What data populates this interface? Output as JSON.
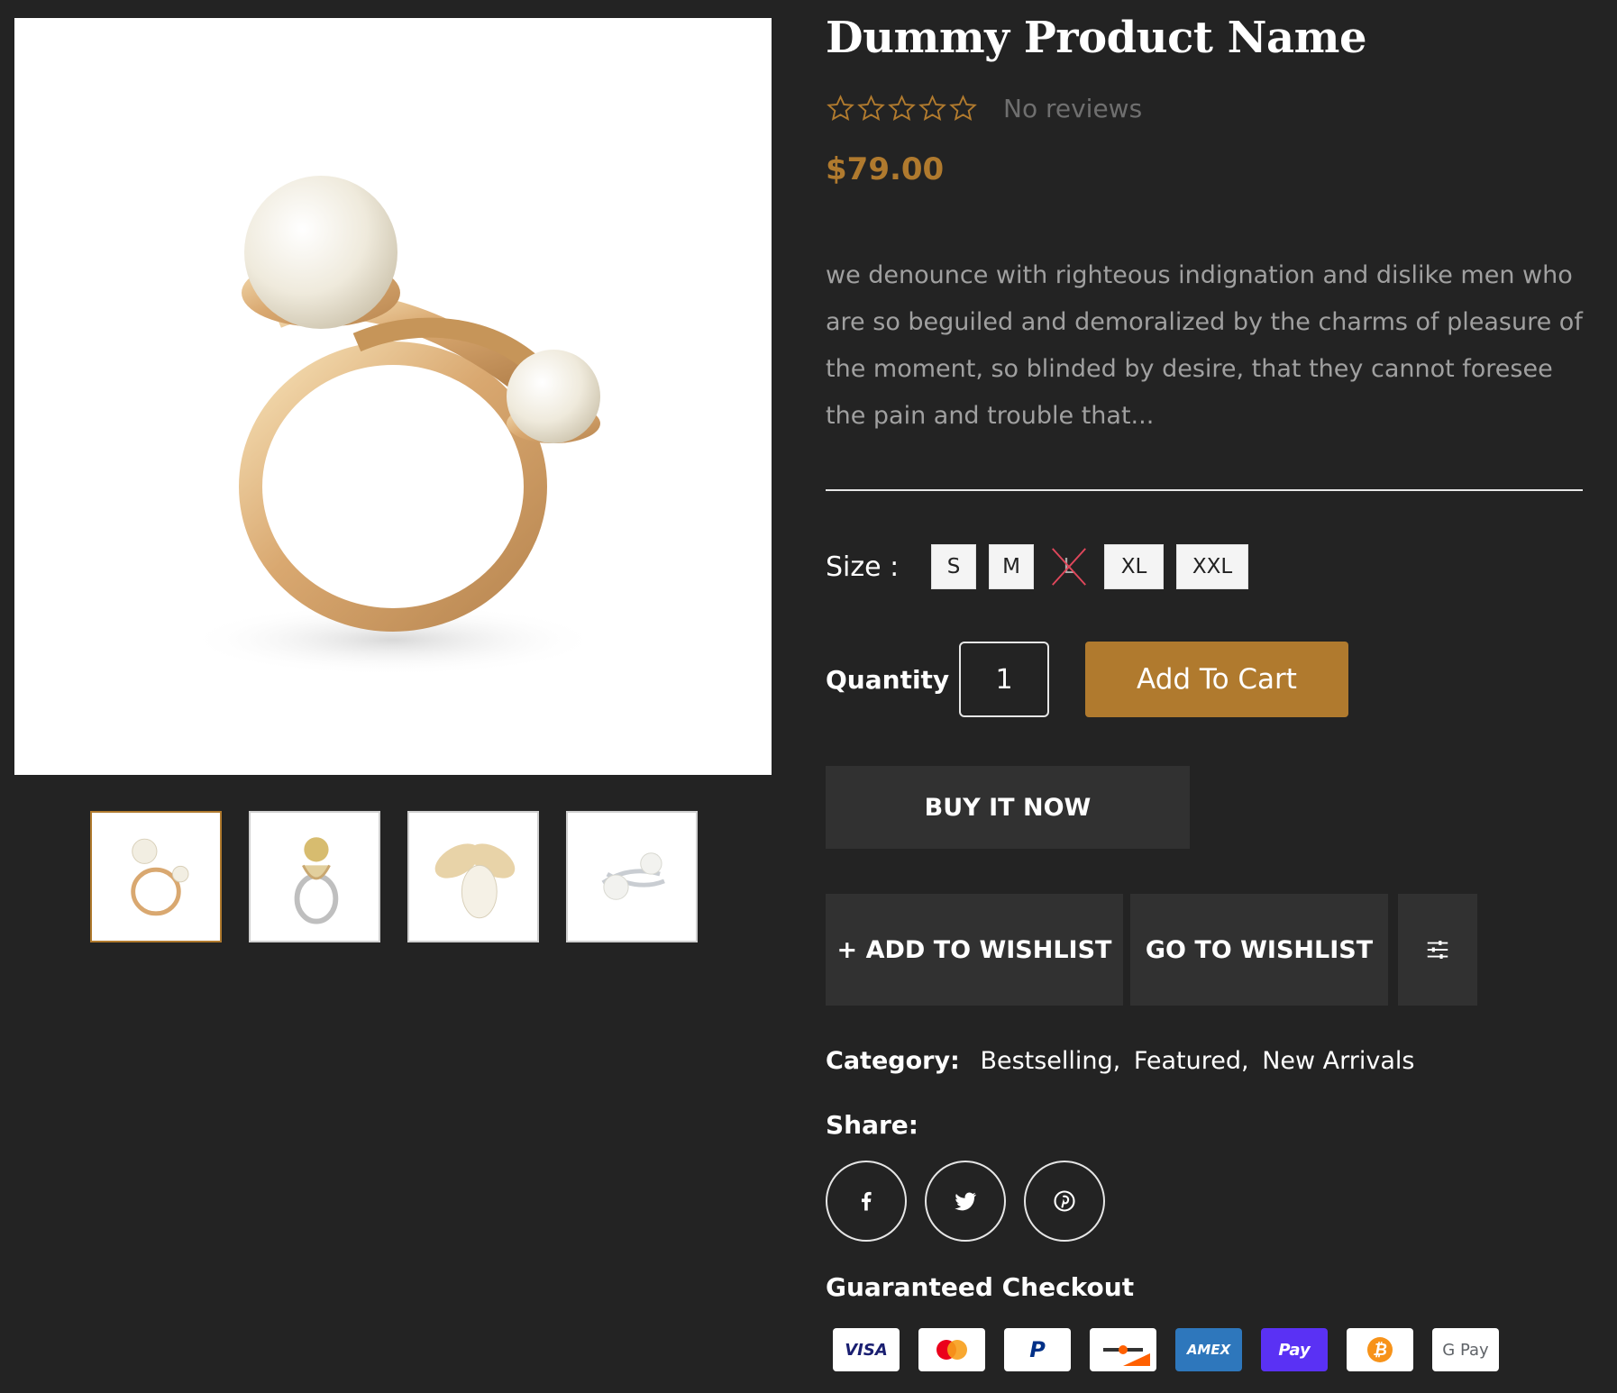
{
  "product": {
    "title": "Dummy Product Name",
    "rating": {
      "stars_filled": 0,
      "stars_total": 5,
      "reviews_text": "No reviews"
    },
    "price": "$79.00",
    "description": "we denounce with righteous indignation and dislike men who are so beguiled and demoralized by the charms of pleasure of the moment, so blinded by desire, that they cannot foresee the pain and trouble that...",
    "size_label": "Size :",
    "sizes": [
      {
        "label": "S",
        "available": true
      },
      {
        "label": "M",
        "available": true
      },
      {
        "label": "L",
        "available": false
      },
      {
        "label": "XL",
        "available": true
      },
      {
        "label": "XXL",
        "available": true
      }
    ],
    "quantity_label": "Quantity",
    "quantity_value": "1",
    "add_to_cart": "Add To Cart",
    "buy_now": "BUY IT NOW",
    "add_to_wishlist": "+ ADD TO WISHLIST",
    "go_to_wishlist": "GO TO WISHLIST",
    "category_label": "Category:",
    "categories": [
      "Bestselling,",
      "Featured,",
      "New Arrivals"
    ],
    "share_label": "Share:",
    "share_icons": [
      "facebook-icon",
      "twitter-icon",
      "pinterest-icon"
    ],
    "checkout_label": "Guaranteed Checkout",
    "payment_methods": [
      {
        "name": "visa",
        "text": "VISA",
        "color": "#1a1f71"
      },
      {
        "name": "mastercard",
        "text": "",
        "color": "#eb001b"
      },
      {
        "name": "paypal",
        "text": "P",
        "color": "#003087"
      },
      {
        "name": "discover",
        "text": "",
        "color": "#ff6000"
      },
      {
        "name": "amex",
        "text": "AMEX",
        "color": "#2e77bc"
      },
      {
        "name": "shop-pay",
        "text": "Pay",
        "color": "#5a31f4"
      },
      {
        "name": "bitcoin",
        "text": "₿",
        "color": "#f7931a"
      },
      {
        "name": "google-pay",
        "text": "G Pay",
        "color": "#5f6368"
      }
    ]
  },
  "colors": {
    "background": "#232323",
    "accent": "#b07a2e",
    "button_dark": "#313131",
    "muted_text": "#a0a0a0"
  },
  "gallery": {
    "images": [
      "pearl-ring-gold-main",
      "gold-pearl-ring-diamond",
      "bee-brooch-pearl",
      "silver-double-pearl-ring"
    ],
    "active_index": 0
  }
}
